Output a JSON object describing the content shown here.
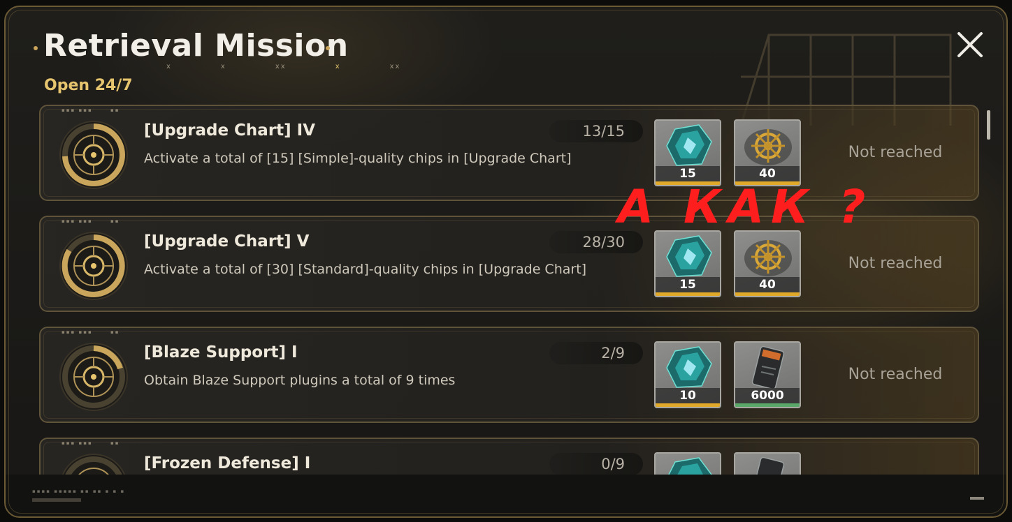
{
  "window": {
    "title": "Retrieval Mission",
    "subtitle": "Open 24/7",
    "title_marks": [
      "x",
      "x",
      "xx",
      "x",
      "xx"
    ]
  },
  "colors": {
    "accent_gold": "#e6c56e",
    "status_text": "#a8a297",
    "annotation_red": "#ff1e1e",
    "reward_bar_orange": "#e0a92a",
    "reward_bar_green": "#5aa76a"
  },
  "annotation": {
    "text": "А КАК ?"
  },
  "missions": [
    {
      "title": "[Upgrade Chart] IV",
      "description": "Activate a total of [15] [Simple]-quality chips in [Upgrade Chart]",
      "progress": "13/15",
      "progress_fraction": 0.87,
      "status": "Not reached",
      "rewards": [
        {
          "icon": "crystal-icon",
          "qty": "15"
        },
        {
          "icon": "gold-emblem-icon",
          "qty": "40"
        }
      ]
    },
    {
      "title": "[Upgrade Chart] V",
      "description": "Activate a total of [30] [Standard]-quality chips in [Upgrade Chart]",
      "progress": "28/30",
      "progress_fraction": 0.93,
      "status": "Not reached",
      "rewards": [
        {
          "icon": "crystal-icon",
          "qty": "15"
        },
        {
          "icon": "gold-emblem-icon",
          "qty": "40"
        }
      ]
    },
    {
      "title": "[Blaze Support] I",
      "description": "Obtain Blaze Support plugins a total of 9 times",
      "progress": "2/9",
      "progress_fraction": 0.22,
      "status": "Not reached",
      "rewards": [
        {
          "icon": "crystal-icon",
          "qty": "10"
        },
        {
          "icon": "credit-card-icon",
          "qty": "6000"
        }
      ]
    },
    {
      "title": "[Frozen Defense] I",
      "description": "",
      "progress": "0/9",
      "progress_fraction": 0.0,
      "status": "",
      "rewards": [
        {
          "icon": "crystal-icon",
          "qty": ""
        },
        {
          "icon": "credit-card-icon",
          "qty": ""
        }
      ]
    }
  ]
}
